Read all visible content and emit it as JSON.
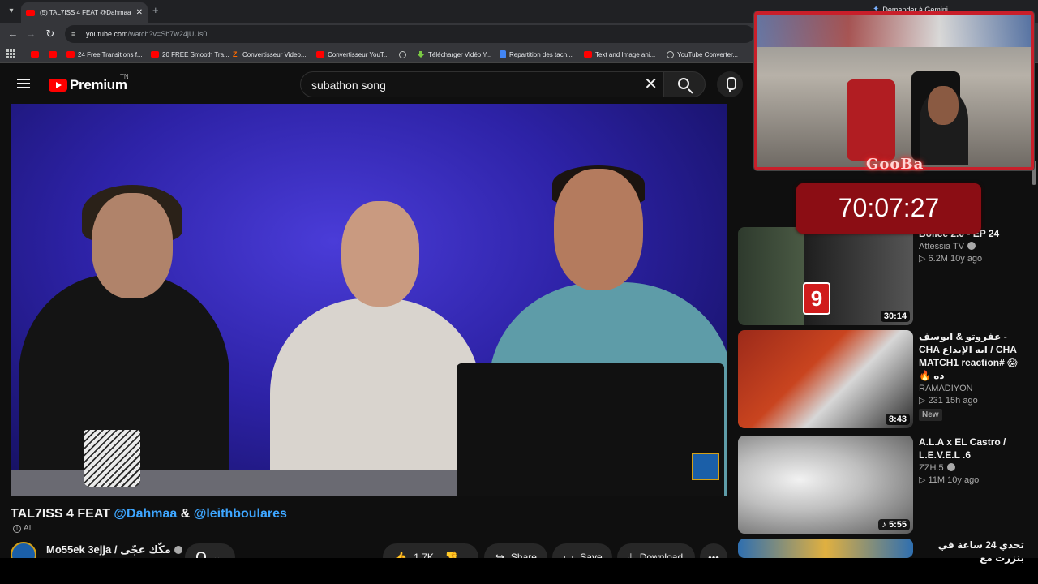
{
  "browser": {
    "tab_title": "(5) TAL7ISS 4 FEAT @Dahmaa &",
    "url_host": "youtube.com",
    "url_path": "/watch?v=Sb7w24jUUs0",
    "gemini_label": "Demander à Gemini",
    "bookmarks": [
      {
        "label": "",
        "icon": "youtube-icon"
      },
      {
        "label": "",
        "icon": "youtube-icon"
      },
      {
        "label": "24 Free Transitions f...",
        "icon": "youtube-icon"
      },
      {
        "label": "20 FREE Smooth Tra...",
        "icon": "youtube-icon"
      },
      {
        "label": "Convertisseur Video...",
        "icon": "z-icon"
      },
      {
        "label": "Convertisseur YouT...",
        "icon": "youtube-icon"
      },
      {
        "label": "",
        "icon": "globe-icon"
      },
      {
        "label": "Télécharger Vidéo Y...",
        "icon": "download-icon"
      },
      {
        "label": "Repartition des tach...",
        "icon": "doc-icon"
      },
      {
        "label": "Text and Image ani...",
        "icon": "youtube-icon"
      },
      {
        "label": "YouTube Converter...",
        "icon": "globe-icon"
      }
    ]
  },
  "youtube": {
    "logo_text": "Premium",
    "country_code": "TN",
    "search_query": "subathon song"
  },
  "video": {
    "title_prefix": "TAL7ISS 4 FEAT ",
    "mention1": "@Dahmaa",
    "amp": " & ",
    "mention2": "@leithboulares",
    "ai_label": "AI",
    "channel_name": "Mo55ek 3ejja / مكّك عجّى",
    "likes": "1.7K",
    "share_label": "Share",
    "save_label": "Save",
    "download_label": "Download"
  },
  "sidebar": [
    {
      "title": "Bolice 2.0 - EP 24",
      "channel": "Attessia TV",
      "stats": "▷ 6.2M  10y ago",
      "duration": "30:14",
      "badge": "",
      "thumb_color": "#3c4a3a"
    },
    {
      "title": "عفروتو & ايوسف - CHA ايه الإبداع / CHA MATCH1 reaction# 😱🔥 ده",
      "channel": "RAMADIYON",
      "stats": "▷ 231  15h ago",
      "duration": "8:43",
      "badge": "New",
      "thumb_color": "#7a2a1c"
    },
    {
      "title": "A.L.A x EL Castro / L.E.V.E.L .6",
      "channel": "ZZH.5",
      "stats": "▷ 11M  10y ago",
      "duration": "5:55",
      "badge": "",
      "thumb_color": "#cfcfcf"
    },
    {
      "title": "تحدي 24 ساعة في بنزرت مع",
      "channel": "",
      "stats": "",
      "duration": "",
      "badge": "",
      "thumb_color": "#2f6fb0"
    }
  ],
  "overlay": {
    "name_tag": "GooBa",
    "timer": "70:07:27"
  },
  "colors": {
    "accent_red": "#ff0000",
    "mention_blue": "#3ea6ff",
    "timer_bg": "#8b0d14"
  }
}
